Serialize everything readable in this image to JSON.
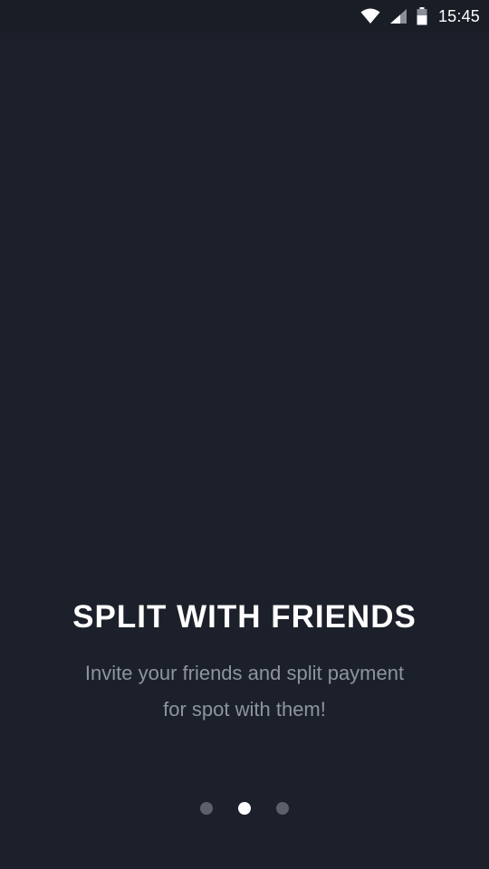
{
  "status_bar": {
    "time": "15:45",
    "icons": [
      "wifi-icon",
      "signal-icon",
      "battery-icon"
    ]
  },
  "onboarding": {
    "title": "SPLIT WITH FRIENDS",
    "subtitle_line1": "Invite your friends and split payment",
    "subtitle_line2": "for spot with them!"
  },
  "pagination": {
    "total": 3,
    "active_index": 1
  },
  "colors": {
    "background": "#1c202a",
    "status_bar": "#191d26",
    "title": "#ffffff",
    "subtitle": "#8e949e",
    "dot_inactive": "#5b606a",
    "dot_active": "#ffffff"
  }
}
